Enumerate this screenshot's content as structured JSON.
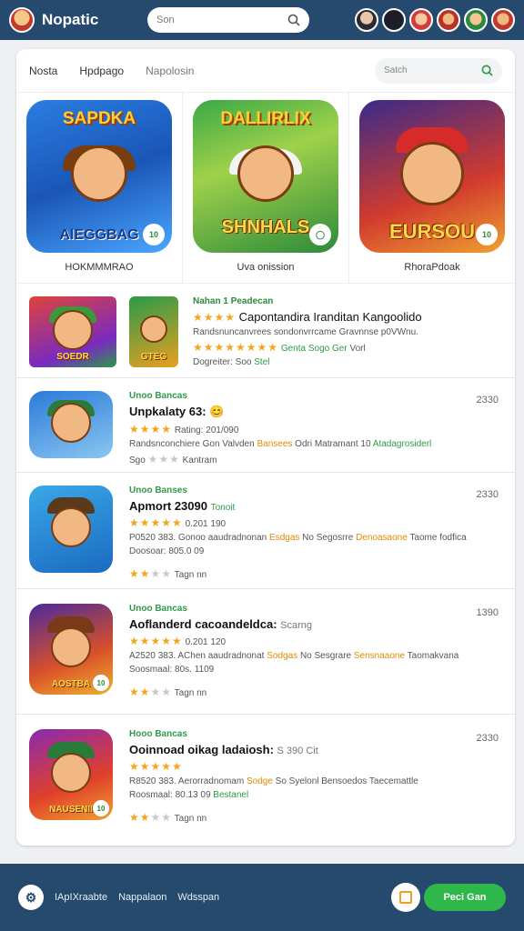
{
  "header": {
    "title": "Nopatic",
    "search_placeholder": "Son"
  },
  "tabs": [
    {
      "label": "Nosta"
    },
    {
      "label": "Hpdpago"
    },
    {
      "label": "Napolosin"
    }
  ],
  "panel_search_placeholder": "Satch",
  "featured": [
    {
      "top_text": "SAPDKA",
      "caption": "AlEGGBAG",
      "badge": "10",
      "label": "HOKMMMRAO"
    },
    {
      "top_text": "DALLIRLIX",
      "caption": "SHNHALS",
      "badge": "",
      "label": "Uva onission"
    },
    {
      "top_text": "",
      "caption": "EURSOU",
      "badge": "10",
      "label": "RhoraPdoak"
    }
  ],
  "list": [
    {
      "category": "Nahan 1 Peadecan",
      "title": "Capontandira Iranditan Kangoolido",
      "line1": "Randsnuncanvrees sondonvrrcame Gravnnse p0VWnu.",
      "line2_highlight": "Genta Sogo Ger",
      "line2_rest": "Vorl",
      "line3": "Dogreiter: Soo",
      "line3_highlight": "Stel",
      "price": "",
      "thumb_caption": "SOEDR",
      "thumb2_caption": "GTEG"
    },
    {
      "category": "Unoo Bancas",
      "title": "Unpkalaty 63:",
      "line1_prefix": "Randsnconchiere Gon Valvden",
      "line1_highlight": "Bansees",
      "line1_mid": "Odri Matramant 10",
      "line1_green": "Atadagrosiderl",
      "line2_prefix": "Rating:",
      "line2_value": "201/090",
      "line3": "Sgo",
      "line3_rest": "Kantram",
      "price": "2330",
      "thumb_caption": ""
    },
    {
      "category": "Unoo Banses",
      "title": "Apmort 23090",
      "title_green": "Tonoit",
      "rating_text": "0.201 190",
      "line1_prefix": "P0520 383. Gonoo aaudradnonan",
      "line1_highlight": "Esdgas",
      "line1_mid": "No Segosrre",
      "line1_orange": "Denoasaone",
      "line1_rest": "Taome fodfica",
      "line2": "Doosoar: 805.0 09",
      "line3_rest": "Tagn nn",
      "price": "2330",
      "thumb_caption": ""
    },
    {
      "category": "Unoo Bancas",
      "title": "Aoflanderd cacoandeldca:",
      "title_gray": "Scarng",
      "rating_text": "0.201 120",
      "line1_prefix": "A2520 383. AChen aaudradnonat",
      "line1_highlight": "Sodgas",
      "line1_mid": "No Sesgrare",
      "line1_orange": "Sensnaaone",
      "line1_rest": "Taomakvana",
      "line2": "Soosmaal: 80s. 1109",
      "line3_rest": "Tagn nn",
      "price": "1390",
      "thumb_caption": "AOSTBA",
      "badge": "10"
    },
    {
      "category": "Hooo Bancas",
      "title": "Ooinnoad oikag ladaiosh:",
      "title_gray": "S 390 Cit",
      "rating_text": "",
      "line1_prefix": "R8520 383. Aerorradnomam",
      "line1_highlight": "Sodge",
      "line1_mid": "So Syelonl Bensoedos",
      "line1_rest": "Taecemattle",
      "line2": "Roosmaal: 80.13 09",
      "line2_green": "Bestanel",
      "line3_rest": "Tagn nn",
      "price": "2330",
      "thumb_caption": "NAUSENII",
      "badge": "10"
    }
  ],
  "bottom": {
    "links": [
      "IApIXraabte",
      "Nappalaon",
      "Wdsspan"
    ],
    "cta": "Peci Gan"
  },
  "colors": {
    "header_bg": "#264a6e",
    "accent_green": "#2eb84b",
    "star": "#f2a71b"
  }
}
